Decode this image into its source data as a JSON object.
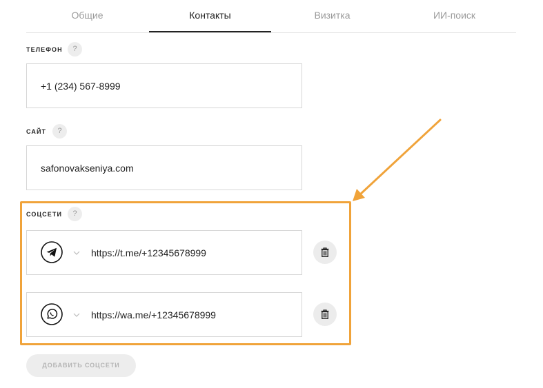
{
  "tabs": [
    {
      "label": "Общие"
    },
    {
      "label": "Контакты"
    },
    {
      "label": "Визитка"
    },
    {
      "label": "ИИ-поиск"
    }
  ],
  "phone": {
    "label": "ТЕЛЕФОН",
    "help": "?",
    "value": "+1 (234) 567-8999"
  },
  "site": {
    "label": "САЙТ",
    "help": "?",
    "value": "safonovakseniya.com"
  },
  "social": {
    "label": "СОЦСЕТИ",
    "help": "?",
    "items": [
      {
        "icon": "telegram-icon",
        "value": "https://t.me/+12345678999"
      },
      {
        "icon": "whatsapp-icon",
        "value": "https://wa.me/+12345678999"
      }
    ],
    "add_label": "ДОБАВИТЬ СОЦСЕТИ"
  },
  "colors": {
    "highlight": "#f0a33a",
    "active_tab": "#222222",
    "inactive_tab": "#9a9a9a"
  }
}
